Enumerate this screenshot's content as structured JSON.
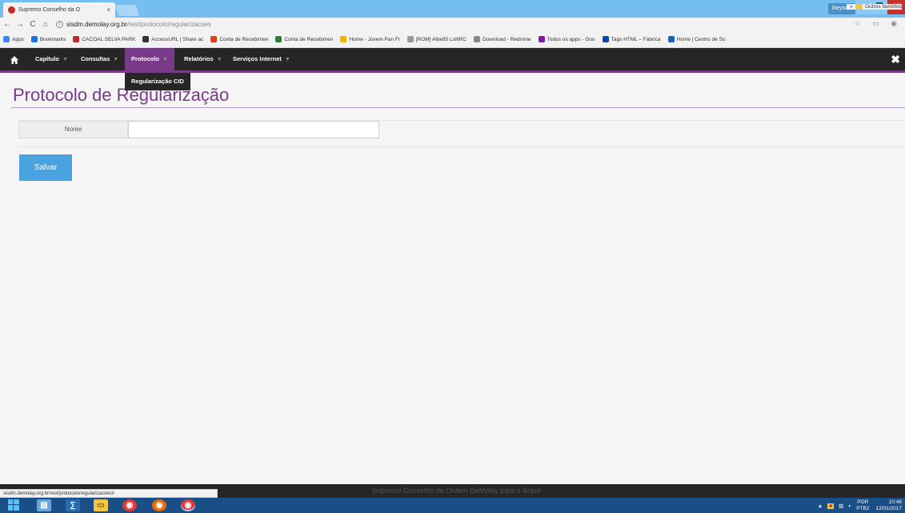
{
  "browser": {
    "tab_title": "Supremo Conselho da O",
    "tab_close": "×",
    "url_host": "sisdm.demolay.org.br",
    "url_path": "/rest/protocolo/regularizacoes",
    "user_name": "iheyson",
    "bookmarks": [
      {
        "label": "Apps",
        "color": "#4285f4"
      },
      {
        "label": "Bookmarks",
        "color": "#1a73e8"
      },
      {
        "label": "CACOAL SELVA PARK",
        "color": "#c62828"
      },
      {
        "label": "AccessURL | Share ac",
        "color": "#333333"
      },
      {
        "label": "Conta de Recebimen",
        "color": "#d84315"
      },
      {
        "label": "Conta de Recebimen",
        "color": "#2e7d32"
      },
      {
        "label": "Home - Jovem Pan FI",
        "color": "#f4b400"
      },
      {
        "label": "[ROM] Albe95 LolliRC",
        "color": "#999999"
      },
      {
        "label": "Download - Redmine",
        "color": "#888888"
      },
      {
        "label": "Todos os apps - Goo",
        "color": "#7b1fa2"
      },
      {
        "label": "Tags HTML – Fábrica",
        "color": "#0d47a1"
      },
      {
        "label": "Home | Centro de So",
        "color": "#1565c0"
      }
    ],
    "bookmarks_overflow": "»",
    "other_bookmarks": "Outros favoritos"
  },
  "nav": {
    "items": [
      {
        "label": "Capítulo",
        "active": false
      },
      {
        "label": "Consultas",
        "active": false
      },
      {
        "label": "Protocolo",
        "active": true
      },
      {
        "label": "Relatórios",
        "active": false
      },
      {
        "label": "Serviços Internet",
        "active": false
      }
    ],
    "caret": "▼",
    "close_glyph": "✖",
    "dropdown_item": "Regularização CID"
  },
  "page": {
    "title": "Protocolo de Regularização",
    "form": {
      "name_label": "Nome",
      "name_value": ""
    },
    "save_label": "Salvar"
  },
  "footer": {
    "status_url": "sisdm.demolay.org.br/rest/protocolo/regularizacoes#",
    "site_text": "Supremo Conselho da Ordem DeMolay para o Brasil"
  },
  "taskbar": {
    "lang": "POR",
    "lang_sub": "PTB2",
    "time": "10:48",
    "date": "12/01/2017"
  },
  "colors": {
    "accent": "#7a3a8a",
    "nav_bg": "#262626",
    "button": "#4aa3df"
  }
}
